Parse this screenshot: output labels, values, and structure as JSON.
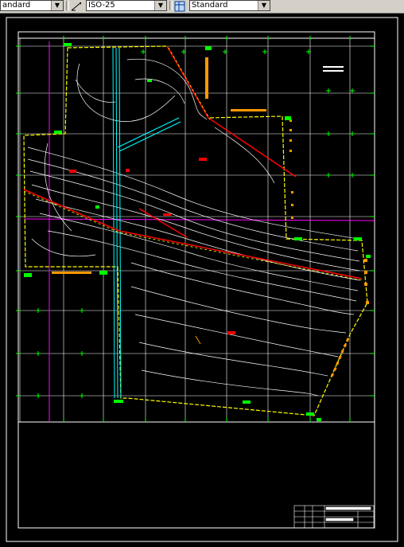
{
  "toolbar": {
    "text_style": "andard",
    "dim_style": "ISO-25",
    "table_style": "Standard"
  },
  "icons": {
    "dim_style_icon": "dimension-style-icon",
    "table_style_icon": "table-style-icon"
  },
  "colors": {
    "background": "#000000",
    "contour": "#ffffff",
    "boundary": "#ffff00",
    "road": "#ff0000",
    "canal": "#00ffff",
    "magenta_line": "#ff00ff",
    "markers": "#00ff00",
    "orange": "#ff9900"
  }
}
